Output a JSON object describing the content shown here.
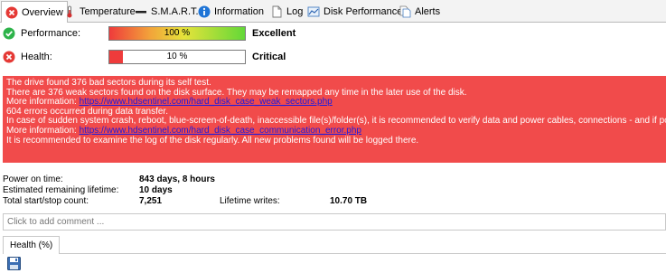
{
  "tabs": [
    {
      "label": "Overview",
      "icon": "error-icon",
      "active": true
    },
    {
      "label": "Temperature",
      "icon": "thermometer-icon"
    },
    {
      "label": "S.M.A.R.T.",
      "icon": "dash-icon"
    },
    {
      "label": "Information",
      "icon": "info-icon"
    },
    {
      "label": "Log",
      "icon": "document-icon"
    },
    {
      "label": "Disk Performance",
      "icon": "chart-icon"
    },
    {
      "label": "Alerts",
      "icon": "alerts-icon"
    }
  ],
  "performance": {
    "label": "Performance:",
    "percent_text": "100 %",
    "value": 100,
    "rating": "Excellent",
    "icon": "check-icon",
    "color": "#2db34a"
  },
  "health": {
    "label": "Health:",
    "percent_text": "10 %",
    "value": 10,
    "rating": "Critical",
    "icon": "error-icon",
    "color": "#e53935"
  },
  "message": {
    "line1": "The drive found 376 bad sectors during its self test.",
    "line2": "There are 376 weak sectors found on the disk surface. They may be remapped any time in the later use of the disk.",
    "more_label": "More information: ",
    "link1": "https://www.hdsentinel.com/hard_disk_case_weak_sectors.php",
    "line4": "604 errors occurred during data transfer.",
    "line5": "In case of sudden system crash, reboot, blue-screen-of-death, inaccessible file(s)/folder(s), it is recommended to verify data and power cables, connections - and if po",
    "link2": "https://www.hdsentinel.com/hard_disk_case_communication_error.php",
    "line7": "It is recommended to examine the log of the disk regularly. All new problems found will be logged there."
  },
  "info": {
    "power_on_label": "Power on time:",
    "power_on_value": "843 days, 8 hours",
    "lifetime_label": "Estimated remaining lifetime:",
    "lifetime_value": "10 days",
    "startstop_label": "Total start/stop count:",
    "startstop_value": "7,251",
    "writes_label": "Lifetime writes:",
    "writes_value": "10.70 TB"
  },
  "comment_placeholder": "Click to add comment ...",
  "subtab_label": "Health (%)"
}
